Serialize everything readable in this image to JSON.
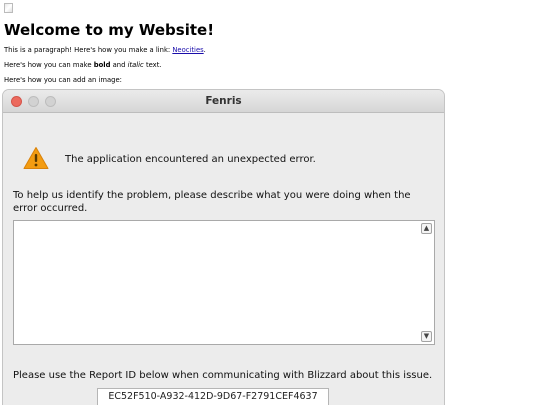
{
  "page": {
    "heading": "Welcome to my Website!",
    "line1_pre": "This is a paragraph! Here's how you make a link: ",
    "line1_link": "Neocities",
    "line1_post": ".",
    "line2_pre": "Here's how you can make ",
    "line2_bold": "bold",
    "line2_mid": " and ",
    "line2_italic": "italic",
    "line2_post": " text.",
    "line3": "Here's how you can add an image:"
  },
  "dialog": {
    "title": "Fenris",
    "error_message": "The application encountered an unexpected error.",
    "describe_prompt": "To help us identify the problem, please describe what you were doing when the error occurred.",
    "description_value": "",
    "report_note": "Please use the Report ID below when communicating with Blizzard about this issue.",
    "report_id": "EC52F510-A932-412D-9D67-F2791CEF4637",
    "icons": {
      "warning": "warning-icon",
      "scroll_up": "chevron-up-icon",
      "scroll_down": "chevron-down-icon"
    },
    "colors": {
      "close_button": "#ec6a5e",
      "warning_fill": "#f39c12"
    }
  }
}
